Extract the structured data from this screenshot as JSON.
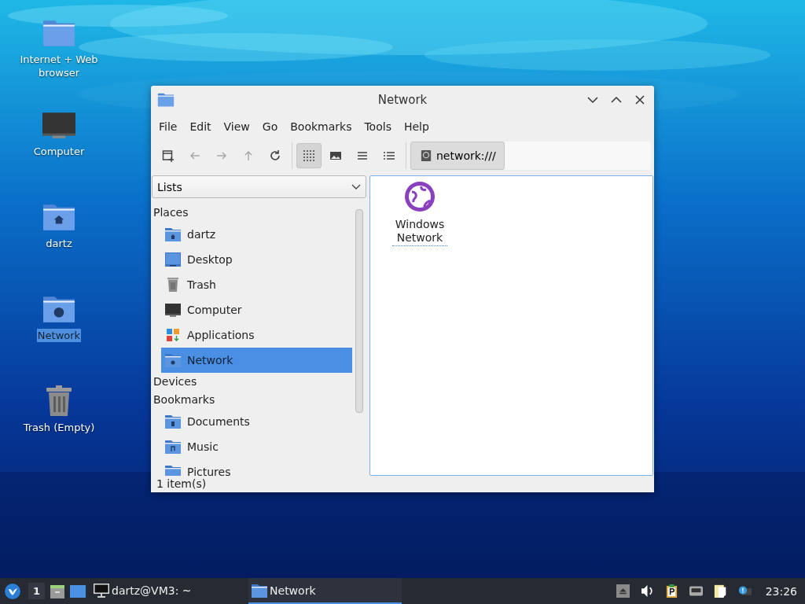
{
  "desktop_icons": [
    {
      "label": "Internet + Web browser",
      "kind": "folder",
      "selected": false
    },
    {
      "label": "Computer",
      "kind": "computer",
      "selected": false
    },
    {
      "label": "dartz",
      "kind": "home",
      "selected": false
    },
    {
      "label": "Network",
      "kind": "network",
      "selected": true
    },
    {
      "label": "Trash (Empty)",
      "kind": "trash",
      "selected": false
    }
  ],
  "window": {
    "title": "Network",
    "menu": [
      "File",
      "Edit",
      "View",
      "Go",
      "Bookmarks",
      "Tools",
      "Help"
    ],
    "nav_buttons": [
      {
        "kind": "new-tab",
        "disabled": false
      },
      {
        "kind": "back",
        "disabled": true
      },
      {
        "kind": "forward",
        "disabled": true
      },
      {
        "kind": "up",
        "disabled": true
      },
      {
        "kind": "reload",
        "disabled": false
      }
    ],
    "view_buttons": [
      {
        "kind": "icons",
        "selected": true
      },
      {
        "kind": "thumbnails",
        "selected": false
      },
      {
        "kind": "compact",
        "selected": false
      },
      {
        "kind": "detailed",
        "selected": false
      }
    ],
    "location": "network:///",
    "side_pane": {
      "mode": "Lists",
      "sections": [
        {
          "title": "Places",
          "items": [
            {
              "label": "dartz",
              "kind": "home",
              "selected": false
            },
            {
              "label": "Desktop",
              "kind": "desktop",
              "selected": false
            },
            {
              "label": "Trash",
              "kind": "trash",
              "selected": false
            },
            {
              "label": "Computer",
              "kind": "computer",
              "selected": false
            },
            {
              "label": "Applications",
              "kind": "apps",
              "selected": false
            },
            {
              "label": "Network",
              "kind": "network",
              "selected": true
            }
          ]
        },
        {
          "title": "Devices"
        },
        {
          "title": "Bookmarks",
          "items": [
            {
              "label": "Documents",
              "kind": "documents",
              "selected": false
            },
            {
              "label": "Music",
              "kind": "music",
              "selected": false
            },
            {
              "label": "Pictures",
              "kind": "pictures",
              "selected": false
            }
          ]
        }
      ]
    },
    "files": [
      {
        "label": "Windows Network",
        "kind": "network",
        "focused": true
      }
    ],
    "status": "1 item(s)"
  },
  "taskbar": {
    "workspace": "1",
    "tasks": [
      {
        "label": "dartz@VM3: ~",
        "kind": "terminal",
        "active": false
      },
      {
        "label": "Network",
        "kind": "folder",
        "active": true
      }
    ],
    "clock": "23:26"
  }
}
